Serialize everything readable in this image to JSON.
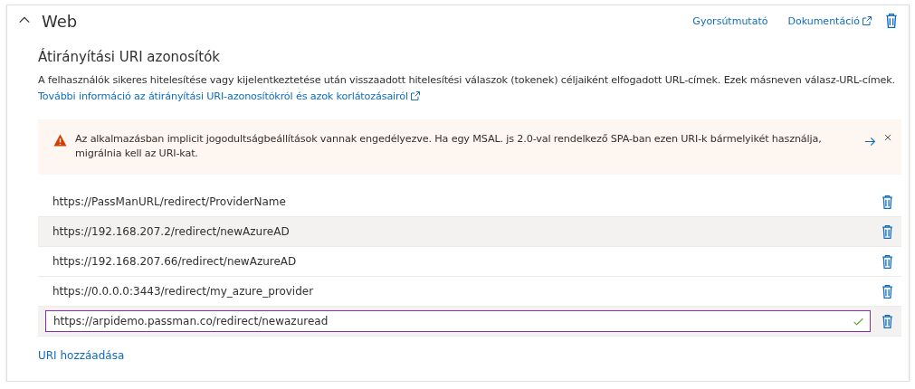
{
  "section": {
    "title": "Web",
    "expanded": true,
    "links": [
      {
        "label": "Gyorsútmutató",
        "external": false
      },
      {
        "label": "Dokumentáció",
        "external": true
      }
    ]
  },
  "redirect": {
    "heading": "Átirányítási URI azonosítók",
    "description": "A felhasználók sikeres hitelesítése vagy kijelentkeztetése után visszaadott hitelesítési válaszok (tokenek) céljaiként elfogadott URL-címek. Ezek másneven válasz-URL-címek.",
    "more_link": "További információ az átirányítási URI-azonosítókról és azok korlátozásairól"
  },
  "warning": {
    "text": "Az alkalmazásban implicit jogodultságbeállítások vannak engedélyezve. Ha egy MSAL. js 2.0-val rendelkező SPA-ban ezen URI-k bármelyikét használja, migrálnia kell az URI-kat."
  },
  "uris": [
    {
      "kind": "text",
      "value": "https://PassManURL/redirect/ProviderName",
      "highlighted": false
    },
    {
      "kind": "text",
      "value": "https://192.168.207.2/redirect/newAzureAD",
      "highlighted": true
    },
    {
      "kind": "text",
      "value": "https://192.168.207.66/redirect/newAzureAD",
      "highlighted": false
    },
    {
      "kind": "text",
      "value": "https://0.0.0.0:3443/redirect/my_azure_provider",
      "highlighted": false
    },
    {
      "kind": "input",
      "value": "https://arpidemo.passman.co/redirect/newazuread",
      "highlighted": true,
      "valid": true
    }
  ],
  "add_link": "URI hozzáadása"
}
